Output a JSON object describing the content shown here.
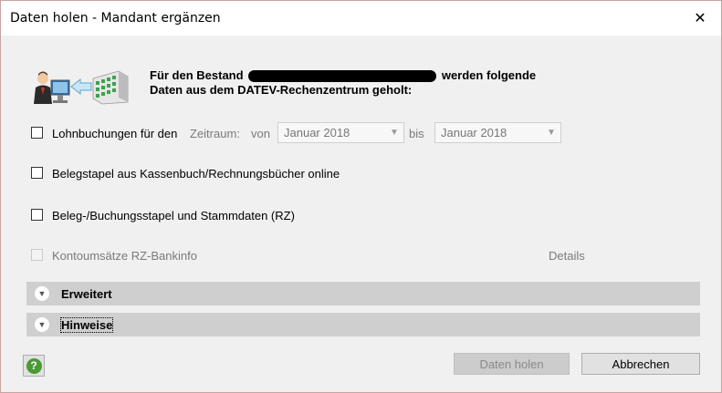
{
  "window": {
    "title": "Daten holen - Mandant ergänzen",
    "close_glyph": "✕"
  },
  "intro": {
    "line1_prefix": "Für den Bestand",
    "line1_suffix": "werden folgende",
    "line2": "Daten aus dem DATEV-Rechenzentrum geholt:"
  },
  "options": {
    "lohn": {
      "label": "Lohnbuchungen für den",
      "zeitraum_label": "Zeitraum:",
      "von_label": "von",
      "von_value": "Januar 2018",
      "bis_label": "bis",
      "bis_value": "Januar 2018"
    },
    "belegstapel": {
      "label": "Belegstapel aus Kassenbuch/Rechnungsbücher online"
    },
    "buchungsstapel": {
      "label": "Beleg-/Buchungsstapel und Stammdaten (RZ)"
    },
    "konto": {
      "label": "Kontoumsätze RZ-Bankinfo",
      "details_label": "Details"
    }
  },
  "sections": {
    "erweitert": "Erweitert",
    "hinweise": "Hinweise"
  },
  "buttons": {
    "daten_holen": "Daten holen",
    "abbrechen": "Abbrechen",
    "help": "?"
  }
}
